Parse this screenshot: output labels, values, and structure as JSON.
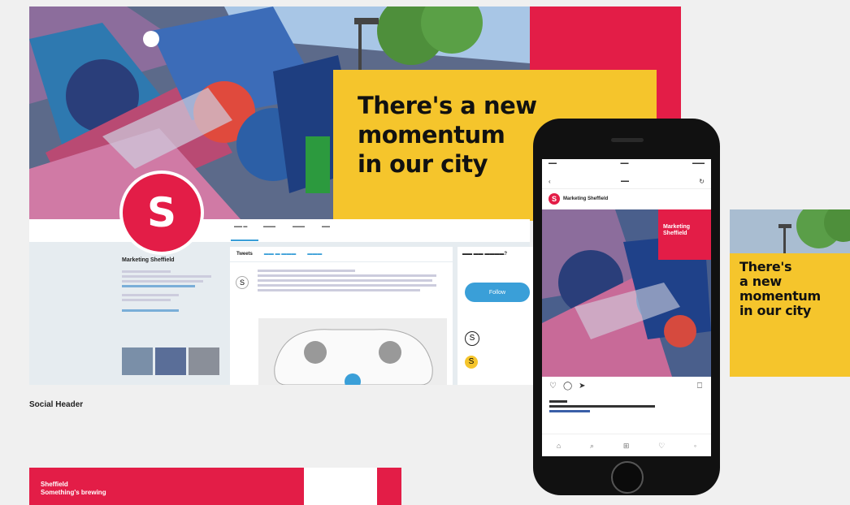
{
  "campaign": {
    "headline": "There's a new\nmomentum\nin our city",
    "headline_square": "There's\na new\nmomentum\nin our city",
    "logo_letter": "S"
  },
  "twitter": {
    "nav": [
      "",
      "",
      "",
      ""
    ],
    "profile_name": "Marketing Sheffield",
    "handle": "",
    "bio": "",
    "feed_tabs": [
      "Tweets",
      "",
      ""
    ],
    "who_to_follow": "",
    "follow_label": "Follow"
  },
  "labels": {
    "social_header": "Social Header"
  },
  "banner": {
    "line1": "Sheffield",
    "line2": "Something's brewing"
  },
  "phone": {
    "account": "Marketing Sheffield",
    "tag": "Marketing\nSheffield",
    "likes": "",
    "caption": ""
  },
  "colors": {
    "red": "#e31d47",
    "yellow": "#f5c52c"
  }
}
